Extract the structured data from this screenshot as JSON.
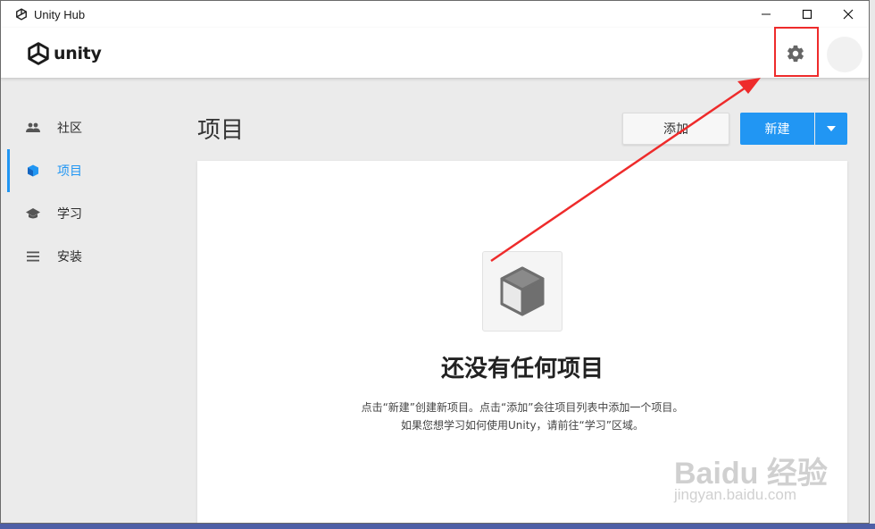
{
  "window": {
    "title": "Unity Hub"
  },
  "header": {
    "logo_text": "unity"
  },
  "sidebar": {
    "items": [
      {
        "label": "社区",
        "icon": "people-icon"
      },
      {
        "label": "项目",
        "icon": "cube-icon",
        "active": true
      },
      {
        "label": "学习",
        "icon": "graduation-cap-icon"
      },
      {
        "label": "安装",
        "icon": "list-icon"
      }
    ]
  },
  "main": {
    "title": "项目",
    "add_button": "添加",
    "new_button": "新建",
    "empty": {
      "title": "还没有任何项目",
      "line1": "点击“新建”创建新项目。点击“添加”会往项目列表中添加一个项目。",
      "line2": "如果您想学习如何使用Unity，请前往“学习”区域。"
    }
  },
  "watermark": {
    "brand": "Baidu 经验",
    "url": "jingyan.baidu.com"
  },
  "colors": {
    "accent": "#2196f3",
    "annotation": "#ee2b2b"
  }
}
